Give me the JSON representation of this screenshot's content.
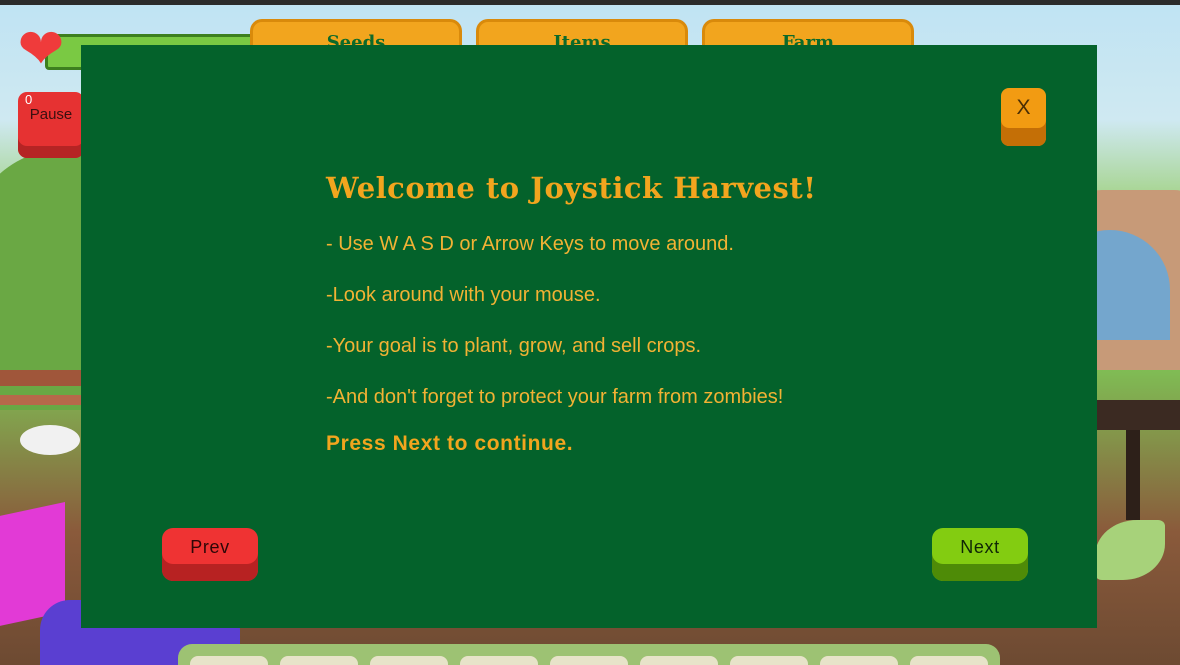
{
  "hud": {
    "heart_icon": "heart-icon",
    "pause_label": "Pause",
    "pause_count": "0",
    "top_tabs": [
      {
        "label": "Seeds"
      },
      {
        "label": "Items"
      },
      {
        "label": "Farm"
      }
    ]
  },
  "modal": {
    "close_label": "X",
    "title": "Welcome to Joystick Harvest!",
    "lines": [
      "- Use W A S D or Arrow Keys to move around.",
      "-Look around with your mouse.",
      "-Your goal is to plant, grow, and sell crops.",
      "-And don't forget to protect your farm from zombies!"
    ],
    "continue_text": "Press Next to continue.",
    "prev_label": "Prev",
    "next_label": "Next"
  },
  "colors": {
    "modal_bg": "#04622b",
    "accent_text": "#f2a51e",
    "prev_button": "#ef3333",
    "next_button": "#83cc11",
    "close_button": "#f29b12"
  }
}
